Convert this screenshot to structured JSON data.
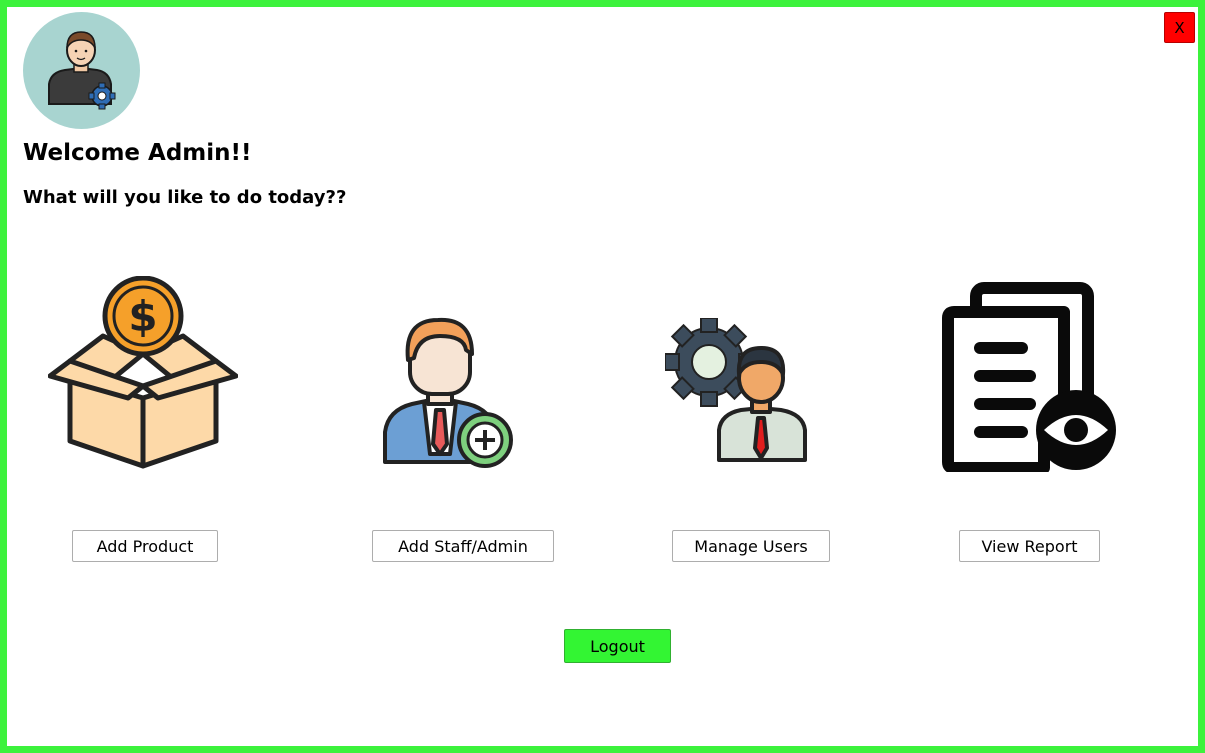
{
  "window": {
    "close_label": "X"
  },
  "header": {
    "welcome": "Welcome Admin!!",
    "question": "What will you like to do today??"
  },
  "actions": [
    {
      "label": "Add Product",
      "icon": "product-box-dollar-icon"
    },
    {
      "label": "Add Staff/Admin",
      "icon": "add-staff-icon"
    },
    {
      "label": "Manage Users",
      "icon": "manage-users-icon"
    },
    {
      "label": "View Report",
      "icon": "view-report-icon"
    }
  ],
  "logout_label": "Logout",
  "colors": {
    "frame_border": "#3cf23c",
    "close_button": "#ff0000",
    "logout_button": "#33f533",
    "avatar_bg": "#a8d4d0"
  }
}
